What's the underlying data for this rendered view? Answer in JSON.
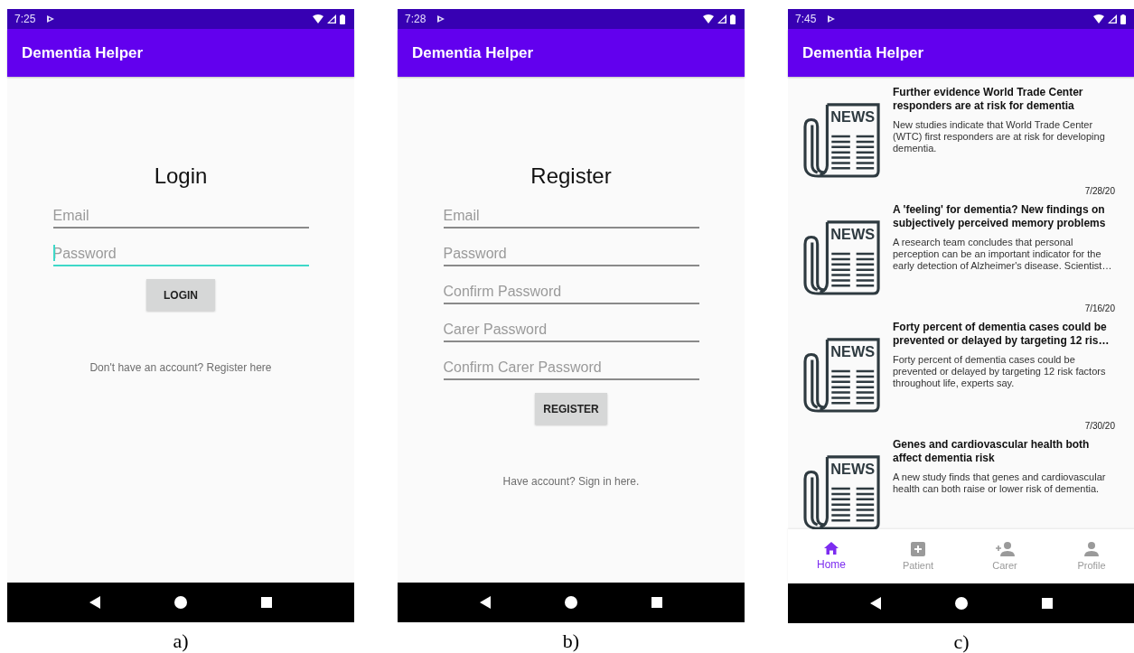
{
  "screens": [
    {
      "kind": "login",
      "caption": "a)",
      "status_time": "7:25",
      "app_title": "Dementia Helper",
      "heading": "Login",
      "fields": [
        {
          "placeholder": "Email",
          "focused": false
        },
        {
          "placeholder": "Password",
          "focused": true
        }
      ],
      "button": "LOGIN",
      "footer_link": "Don't have an account? Register here"
    },
    {
      "kind": "register",
      "caption": "b)",
      "status_time": "7:28",
      "app_title": "Dementia Helper",
      "heading": "Register",
      "fields": [
        {
          "placeholder": "Email",
          "focused": false
        },
        {
          "placeholder": "Password",
          "focused": false
        },
        {
          "placeholder": "Confirm Password",
          "focused": false
        },
        {
          "placeholder": "Carer Password",
          "focused": false
        },
        {
          "placeholder": "Confirm Carer Password",
          "focused": false
        }
      ],
      "button": "REGISTER",
      "footer_link": "Have account? Sign in here."
    },
    {
      "kind": "news",
      "caption": "c)",
      "status_time": "7:45",
      "app_title": "Dementia Helper",
      "articles": [
        {
          "icon_text": "NEWS",
          "title": "Further evidence World Trade Center responders are at risk for dementia",
          "summary": "New studies indicate that World Trade Center (WTC) first responders are at risk for developing dementia.",
          "date": "7/28/20"
        },
        {
          "icon_text": "NEWS",
          "title": "A 'feeling' for dementia? New findings on subjectively perceived memory problems",
          "summary": "A research team concludes that personal perception can be an important indicator for the early detection of Alzheimer's disease. Scientist…",
          "date": "7/16/20"
        },
        {
          "icon_text": "NEWS",
          "title": "Forty percent of dementia cases could be prevented or delayed by targeting 12 ris…",
          "summary": "Forty percent of dementia cases could be prevented or delayed by targeting 12 risk factors throughout life, experts say.",
          "date": "7/30/20"
        },
        {
          "icon_text": "NEWS",
          "title": "Genes and cardiovascular health both affect dementia risk",
          "summary": "A new study finds that genes and cardiovascular health can both raise or lower risk of dementia."
        }
      ],
      "nav": [
        {
          "kind": "home",
          "label": "Home",
          "selected": true
        },
        {
          "kind": "patient",
          "label": "Patient",
          "selected": false
        },
        {
          "kind": "carer",
          "label": "Carer",
          "selected": false
        },
        {
          "kind": "profile",
          "label": "Profile",
          "selected": false
        }
      ]
    }
  ]
}
